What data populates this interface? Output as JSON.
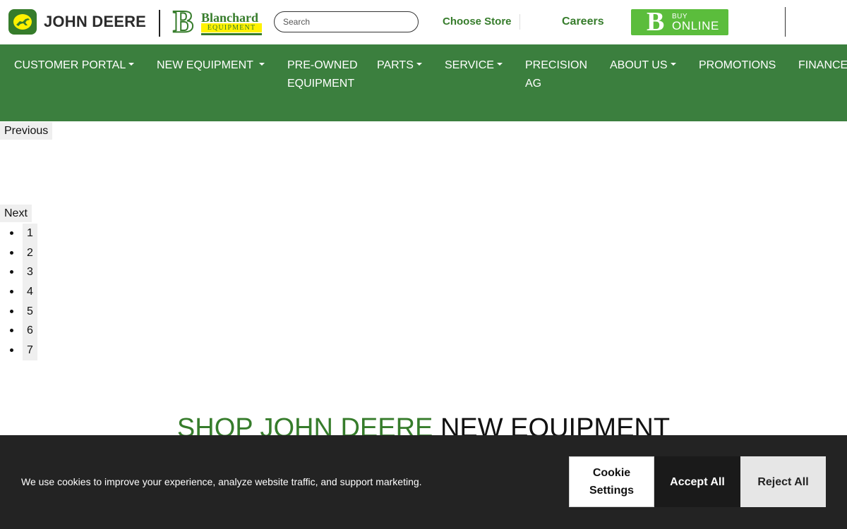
{
  "header": {
    "brand_name": "JOHN DEERE",
    "dealer_name": "Blanchard",
    "dealer_tagline": "EQUIPMENT",
    "search_placeholder": "Search",
    "choose_store": "Choose Store",
    "careers": "Careers",
    "buy_online_small": "BUY",
    "buy_online_big": "ONLINE"
  },
  "nav": {
    "items": [
      {
        "label": "CUSTOMER PORTAL",
        "dropdown": true
      },
      {
        "label": "NEW EQUIPMENT",
        "dropdown": true
      },
      {
        "label": "PRE-OWNED EQUIPMENT",
        "dropdown": false
      },
      {
        "label": "PARTS",
        "dropdown": true
      },
      {
        "label": "SERVICE",
        "dropdown": true
      },
      {
        "label": "PRECISION AG",
        "dropdown": false
      },
      {
        "label": "ABOUT US",
        "dropdown": true
      },
      {
        "label": "PROMOTIONS",
        "dropdown": false
      },
      {
        "label": "FINANCE",
        "dropdown": false
      }
    ]
  },
  "carousel": {
    "previous_label": "Previous",
    "next_label": "Next",
    "indicators": [
      "1",
      "2",
      "3",
      "4",
      "5",
      "6",
      "7"
    ]
  },
  "section": {
    "heading_green": "SHOP JOHN DEERE",
    "heading_dark": "NEW EQUIPMENT"
  },
  "cookie_banner": {
    "message": "We use cookies to improve your experience, analyze website traffic, and support marketing.",
    "settings_label": "Cookie Settings",
    "accept_label": "Accept All",
    "reject_label": "Reject All"
  },
  "colors": {
    "brand_green": "#367c2b",
    "nav_green": "#3b7f3e",
    "buy_online_green": "#5bbd3c",
    "deere_yellow": "#fff200",
    "cookie_bg": "#232323"
  },
  "icons": {
    "brand_logo": "john-deere-leaping-deer-icon",
    "dealer_logo": "blanchard-b-logo",
    "dropdown": "caret-down-icon"
  }
}
